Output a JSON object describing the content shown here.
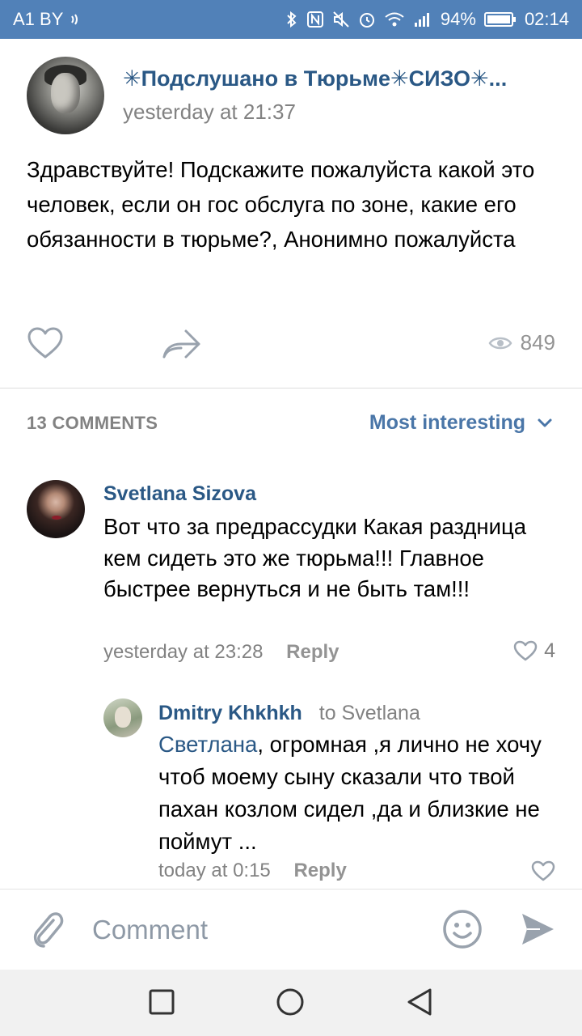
{
  "status_bar": {
    "carrier": "A1 BY",
    "battery": "94%",
    "time": "02:14"
  },
  "post": {
    "group_name": "✳Подслушано в Тюрьме✳СИЗО✳...",
    "time": "yesterday at 21:37",
    "text": "Здравствуйте! Подскажите пожалуйста какой это человек, если он гос обслуга по зоне, какие его обязанности в тюрьме?, Анонимно пожалуйста",
    "views": "849"
  },
  "comments_section": {
    "count_label": "13 COMMENTS",
    "sort_label": "Most interesting"
  },
  "comments": [
    {
      "author": "Svetlana Sizova",
      "text": "Вот что за предрассудки Какая раздница кем сидеть это же тюрьма!!! Главное быстрее вернуться и не быть там!!!",
      "time": "yesterday at 23:28",
      "reply_label": "Reply",
      "likes": "4"
    },
    {
      "author": "Dmitry Khkhkh",
      "to": "to Svetlana",
      "mention": "Светлана",
      "text": ", огромная ,я лично не хочу чтоб моему сыну сказали что твой пахан козлом сидел ,да и близкие не поймут ...",
      "time": "today at 0:15",
      "reply_label": "Reply"
    }
  ],
  "comment_input": {
    "placeholder": "Comment"
  },
  "colors": {
    "status_bar": "#5181b8",
    "link": "#2a5885",
    "accent": "#4a76a8",
    "secondary_text": "#828282",
    "icon": "#99a2ad"
  },
  "icons": {
    "like": "heart-outline-icon",
    "share": "share-arrow-icon",
    "views": "eye-icon",
    "sort": "chevron-down-icon",
    "attach": "paperclip-icon",
    "emoji": "smiley-icon",
    "send": "send-icon"
  }
}
